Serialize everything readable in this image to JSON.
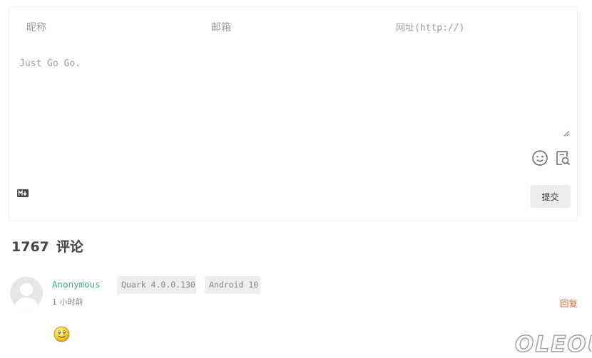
{
  "form": {
    "nickname_placeholder": "昵称",
    "email_placeholder": "邮箱",
    "website_placeholder": "网址(http://)",
    "comment_placeholder": "Just Go Go.",
    "submit_label": "提交",
    "icons": {
      "emoji": "emoji-icon",
      "preview": "preview-icon",
      "markdown": "markdown-icon"
    }
  },
  "comments": {
    "count": "1767",
    "label": "评论",
    "items": [
      {
        "author": "Anonymous",
        "browser": "Quark 4.0.0.130",
        "os": "Android 10",
        "time": "1 小时前",
        "reply_label": "回复",
        "content_emoji": "smile-emoji"
      }
    ]
  },
  "watermark": "OLEOU",
  "colors": {
    "author": "#3bb47a",
    "reply": "#e0632c",
    "badge_bg": "#ededed",
    "button_bg": "#ececec"
  }
}
